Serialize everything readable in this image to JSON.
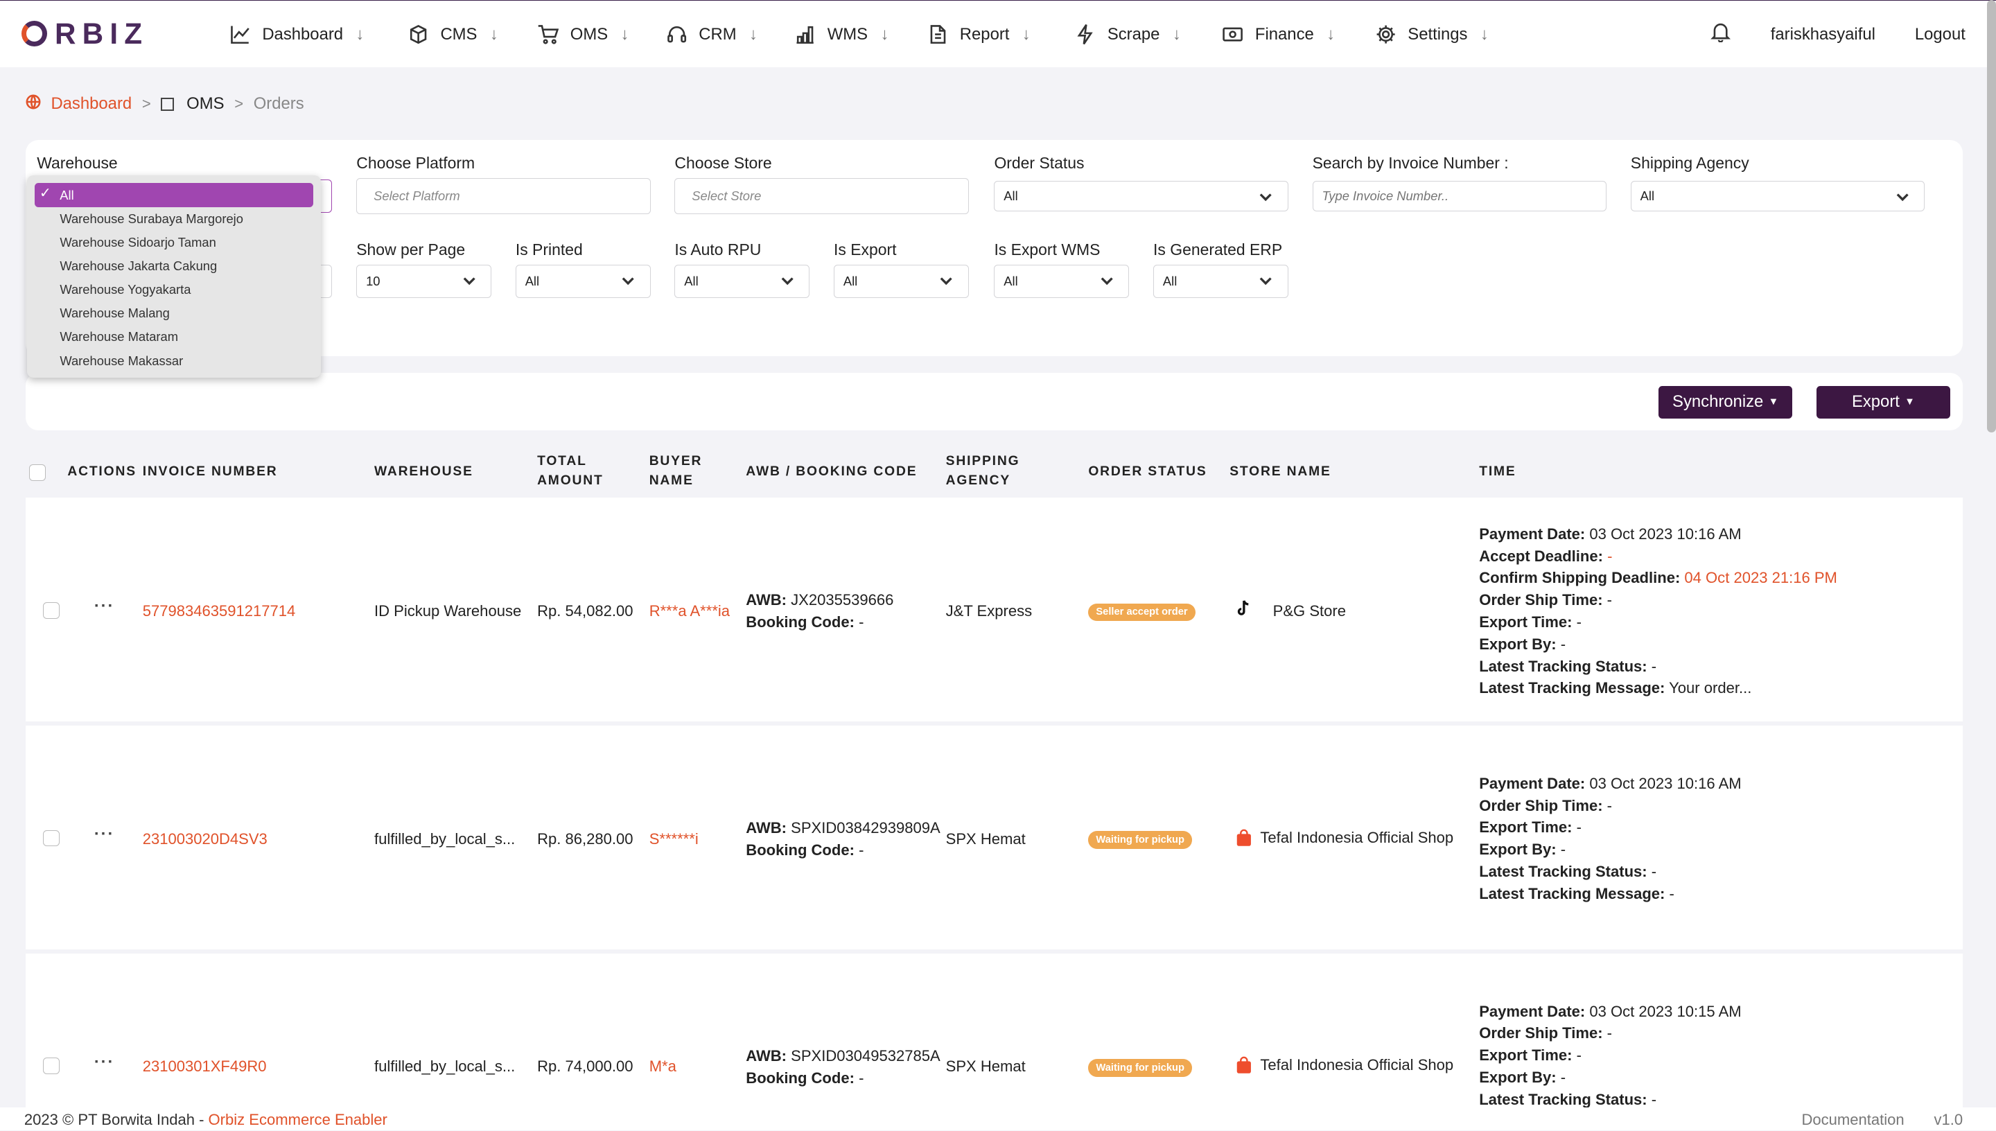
{
  "brand": {
    "logo_text": "RBIZ"
  },
  "nav": {
    "items": [
      {
        "label": "Dashboard",
        "icon": "chart-line-icon"
      },
      {
        "label": "CMS",
        "icon": "box-icon"
      },
      {
        "label": "OMS",
        "icon": "cart-icon"
      },
      {
        "label": "CRM",
        "icon": "headset-icon"
      },
      {
        "label": "WMS",
        "icon": "warehouse-bars-icon"
      },
      {
        "label": "Report",
        "icon": "document-icon"
      },
      {
        "label": "Scrape",
        "icon": "bolt-icon"
      },
      {
        "label": "Finance",
        "icon": "money-icon"
      },
      {
        "label": "Settings",
        "icon": "gear-icon"
      }
    ],
    "arrow": "↓",
    "username": "fariskhasyaiful",
    "logout": "Logout"
  },
  "breadcrumb": {
    "dashboard": "Dashboard",
    "oms": "OMS",
    "orders": "Orders",
    "sep": ">"
  },
  "filters": {
    "warehouse_label": "Warehouse",
    "platform_label": "Choose Platform",
    "platform_placeholder": "Select Platform",
    "store_label": "Choose Store",
    "store_placeholder": "Select Store",
    "order_status_label": "Order Status",
    "order_status_value": "All",
    "invoice_label": "Search by Invoice Number :",
    "invoice_placeholder": "Type Invoice Number..",
    "shipping_label": "Shipping Agency",
    "shipping_value": "All",
    "show_per_page_label": "Show per Page",
    "show_per_page_value": "10",
    "is_printed_label": "Is Printed",
    "is_printed_value": "All",
    "is_auto_rpu_label": "Is Auto RPU",
    "is_auto_rpu_value": "All",
    "is_export_label": "Is Export",
    "is_export_value": "All",
    "is_export_wms_label": "Is Export WMS",
    "is_export_wms_value": "All",
    "is_generated_erp_label": "Is Generated ERP",
    "is_generated_erp_value": "All"
  },
  "warehouse_dropdown": {
    "selected": "All",
    "options": [
      "Warehouse Surabaya Margorejo",
      "Warehouse Sidoarjo Taman",
      "Warehouse Jakarta Cakung",
      "Warehouse Yogyakarta",
      "Warehouse Malang",
      "Warehouse Mataram",
      "Warehouse Makassar"
    ]
  },
  "toolbar": {
    "synchronize": "Synchronize",
    "export": "Export"
  },
  "table": {
    "headers": {
      "actions": "ACTIONS",
      "invoice": "INVOICE NUMBER",
      "warehouse": "WAREHOUSE",
      "total_1": "TOTAL",
      "total_2": "AMOUNT",
      "buyer_1": "BUYER",
      "buyer_2": "NAME",
      "awb": "AWB / BOOKING CODE",
      "ship_1": "SHIPPING",
      "ship_2": "AGENCY",
      "status": "ORDER STATUS",
      "store": "STORE NAME",
      "time": "TIME"
    },
    "rows": [
      {
        "invoice": "577983463591217714",
        "warehouse": "ID Pickup Warehouse",
        "total": "Rp. 54,082.00",
        "buyer": "R***a A***ia",
        "awb_label": "AWB:",
        "awb": "JX2035539666",
        "booking_label": "Booking Code:",
        "booking": "-",
        "shipping": "J&T Express",
        "status": "Seller accept order",
        "store_icon": "tiktok-icon",
        "store": "P&G Store",
        "time": [
          {
            "label": "Payment Date:",
            "value": "03 Oct 2023 10:16 AM",
            "red": false
          },
          {
            "label": "Accept Deadline:",
            "value": "-",
            "red": true
          },
          {
            "label": "Confirm Shipping Deadline:",
            "value": "04 Oct 2023 21:16 PM",
            "red": true
          },
          {
            "label": "Order Ship Time:",
            "value": "-",
            "red": false
          },
          {
            "label": "Export Time:",
            "value": "-",
            "red": false
          },
          {
            "label": "Export By:",
            "value": "-",
            "red": false
          },
          {
            "label": "Latest Tracking Status:",
            "value": "-",
            "red": false
          },
          {
            "label": "Latest Tracking Message:",
            "value": "Your order...",
            "red": false
          }
        ]
      },
      {
        "invoice": "231003020D4SV3",
        "warehouse": "fulfilled_by_local_s...",
        "total": "Rp. 86,280.00",
        "buyer": "S******i",
        "awb_label": "AWB:",
        "awb": "SPXID03842939809A",
        "booking_label": "Booking Code:",
        "booking": "-",
        "shipping": "SPX Hemat",
        "status": "Waiting for pickup",
        "store_icon": "shopee-bag-icon",
        "store": "Tefal Indonesia Official Shop",
        "time": [
          {
            "label": "Payment Date:",
            "value": "03 Oct 2023 10:16 AM",
            "red": false
          },
          {
            "label": "Order Ship Time:",
            "value": "-",
            "red": false
          },
          {
            "label": "Export Time:",
            "value": "-",
            "red": false
          },
          {
            "label": "Export By:",
            "value": "-",
            "red": false
          },
          {
            "label": "Latest Tracking Status:",
            "value": "-",
            "red": false
          },
          {
            "label": "Latest Tracking Message:",
            "value": "-",
            "red": false
          }
        ]
      },
      {
        "invoice": "23100301XF49R0",
        "warehouse": "fulfilled_by_local_s...",
        "total": "Rp. 74,000.00",
        "buyer": "M*a",
        "awb_label": "AWB:",
        "awb": "SPXID03049532785A",
        "booking_label": "Booking Code:",
        "booking": "-",
        "shipping": "SPX Hemat",
        "status": "Waiting for pickup",
        "store_icon": "shopee-bag-icon",
        "store": "Tefal Indonesia Official Shop",
        "time": [
          {
            "label": "Payment Date:",
            "value": "03 Oct 2023 10:15 AM",
            "red": false
          },
          {
            "label": "Order Ship Time:",
            "value": "-",
            "red": false
          },
          {
            "label": "Export Time:",
            "value": "-",
            "red": false
          },
          {
            "label": "Export By:",
            "value": "-",
            "red": false
          },
          {
            "label": "Latest Tracking Status:",
            "value": "-",
            "red": false
          }
        ]
      }
    ]
  },
  "footer": {
    "copyright": "2023 © PT Borwita Indah - ",
    "link": "Orbiz Ecommerce Enabler",
    "documentation": "Documentation",
    "version": "v1.0"
  },
  "colors": {
    "accent": "#e0522a",
    "brand": "#3c1742",
    "selected": "#a046b0",
    "badge": "#f0a850"
  }
}
